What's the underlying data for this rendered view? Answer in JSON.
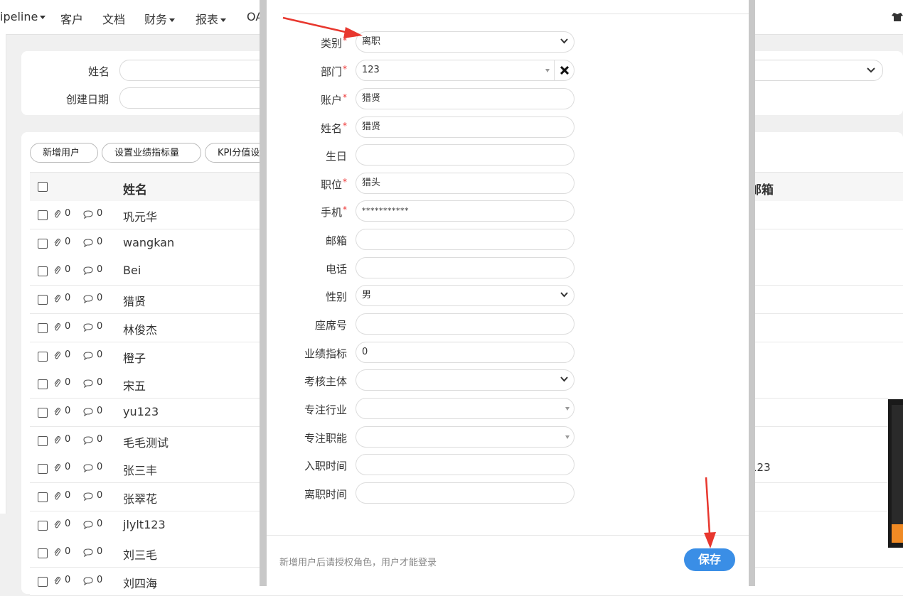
{
  "nav": {
    "items": [
      "ipeline",
      "客户",
      "文档",
      "财务",
      "报表",
      "OA"
    ]
  },
  "filter": {
    "name_label": "姓名",
    "date_label": "创建日期"
  },
  "toolbar": {
    "add_user": "新增用户",
    "set_target": "设置业绩指标量",
    "kpi": "KPI分值设"
  },
  "table": {
    "col_name": "姓名",
    "col_email": "邮箱",
    "rows": [
      {
        "attach": "0",
        "comments": "0",
        "name": "巩元华",
        "email": ""
      },
      {
        "attach": "0",
        "comments": "0",
        "name": "wangkan",
        "email": ""
      },
      {
        "attach": "0",
        "comments": "0",
        "name": "Bei",
        "email": ""
      },
      {
        "attach": "0",
        "comments": "0",
        "name": "猎贤",
        "email": ""
      },
      {
        "attach": "0",
        "comments": "0",
        "name": "林俊杰",
        "email": ""
      },
      {
        "attach": "0",
        "comments": "0",
        "name": "橙子",
        "email": ""
      },
      {
        "attach": "0",
        "comments": "0",
        "name": "宋五",
        "email": ""
      },
      {
        "attach": "0",
        "comments": "0",
        "name": "yu123",
        "email": ""
      },
      {
        "attach": "0",
        "comments": "0",
        "name": "毛毛测试",
        "email": ""
      },
      {
        "attach": "0",
        "comments": "0",
        "name": "张三丰",
        "email": "123"
      },
      {
        "attach": "0",
        "comments": "0",
        "name": "张翠花",
        "email": ""
      },
      {
        "attach": "0",
        "comments": "0",
        "name": "jlylt123",
        "email": ""
      },
      {
        "attach": "0",
        "comments": "0",
        "name": "刘三毛",
        "email": ""
      },
      {
        "attach": "0",
        "comments": "0",
        "name": "刘四海",
        "email": ""
      }
    ]
  },
  "form": {
    "category_label": "类别",
    "category_value": "离职",
    "dept_label": "部门",
    "dept_value": "123",
    "account_label": "账户",
    "account_value": "猎贤",
    "name_label": "姓名",
    "name_value": "猎贤",
    "birthday_label": "生日",
    "birthday_value": "",
    "position_label": "职位",
    "position_value": "猎头",
    "phone_label": "手机",
    "phone_value": "***********",
    "email_label": "邮箱",
    "email_value": "",
    "tel_label": "电话",
    "tel_value": "",
    "gender_label": "性别",
    "gender_value": "男",
    "seat_label": "座席号",
    "seat_value": "",
    "target_label": "业绩指标",
    "target_value": "0",
    "assess_label": "考核主体",
    "assess_value": "",
    "industry_label": "专注行业",
    "industry_value": "",
    "function_label": "专注职能",
    "function_value": "",
    "join_label": "入职时间",
    "join_value": "",
    "leave_label": "离职时间",
    "leave_value": "",
    "required_mark": "*"
  },
  "footer": {
    "note": "新增用户后请授权角色，用户才能登录",
    "save": "保存"
  },
  "colors": {
    "accent": "#3a8ee6",
    "required": "#e33333",
    "arrow": "#e8372e"
  }
}
